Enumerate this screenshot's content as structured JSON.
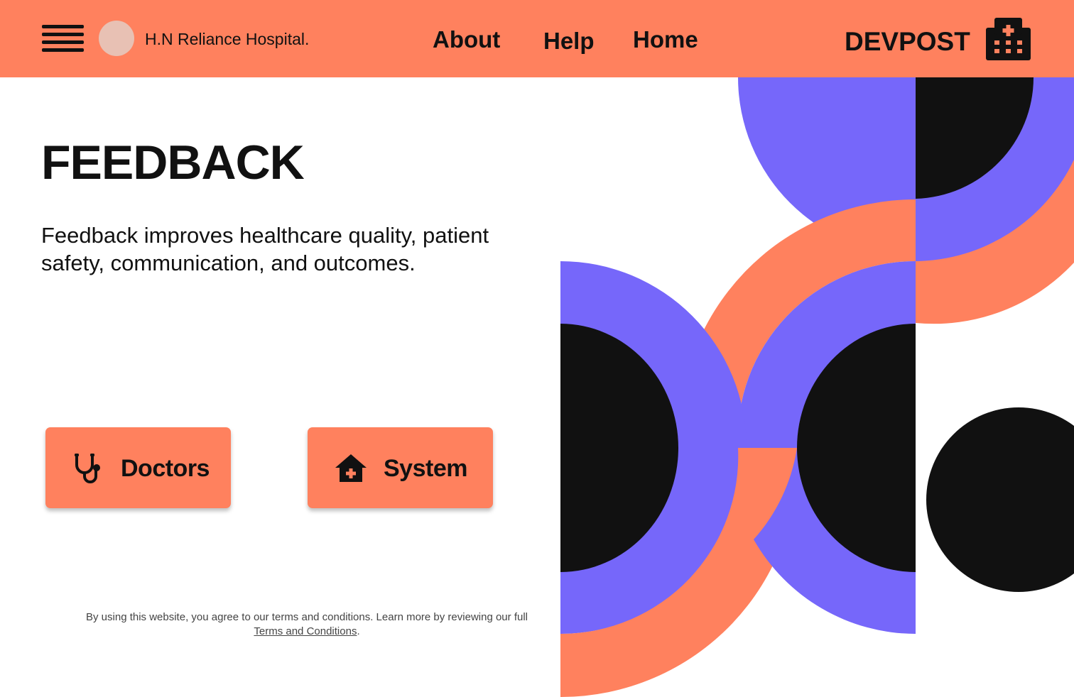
{
  "header": {
    "brand_name": "H.N Reliance Hospital.",
    "nav": {
      "about": "About",
      "help": "Help",
      "home": "Home"
    },
    "devpost": "DEVPOST",
    "icons": {
      "menu": "hamburger-menu-icon",
      "logo": "logo-circle",
      "hospital": "hospital-icon"
    }
  },
  "main": {
    "title": "FEEDBACK",
    "description": "Feedback improves healthcare quality, patient safety, communication, and outcomes.",
    "buttons": {
      "doctors": {
        "label": "Doctors",
        "icon": "stethoscope-icon"
      },
      "system": {
        "label": "System",
        "icon": "home-health-icon"
      }
    }
  },
  "footer": {
    "terms_text": "By using this website, you agree to our terms and conditions. Learn more by reviewing our full",
    "terms_link": "Terms and Conditions",
    "terms_end": "."
  },
  "colors": {
    "accent": "#ff815e",
    "purple": "#7667fa",
    "dark": "#111111",
    "logo": "#e8c1b4"
  }
}
